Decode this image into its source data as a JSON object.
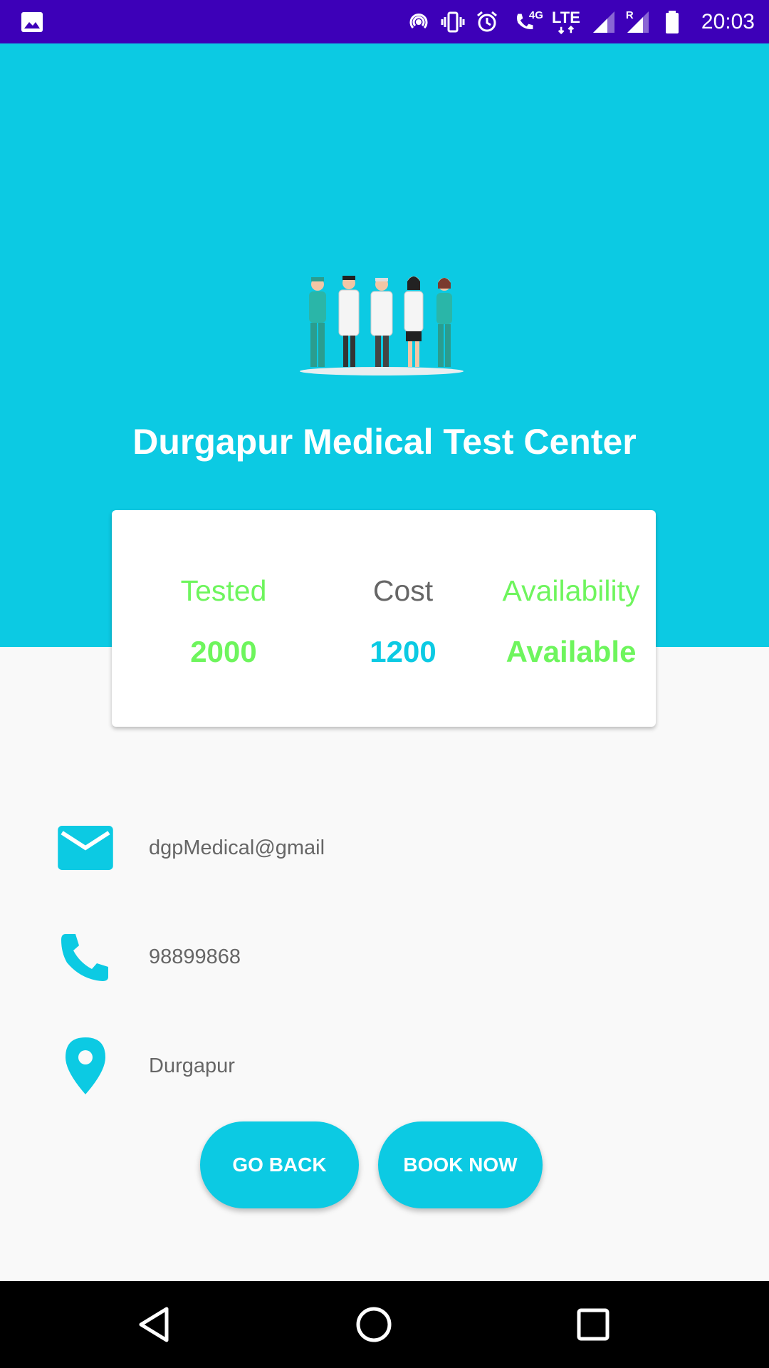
{
  "status_bar": {
    "time": "20:03",
    "network_label": "4G",
    "lte_label": "LTE",
    "roaming_label": "R"
  },
  "header": {
    "title": "Durgapur Medical Test Center"
  },
  "stats": {
    "tested_label": "Tested",
    "tested_value": "2000",
    "cost_label": "Cost",
    "cost_value": "1200",
    "availability_label": "Availability",
    "availability_value": "Available"
  },
  "contact": {
    "email": "dgpMedical@gmail",
    "phone": "98899868",
    "location": "Durgapur"
  },
  "buttons": {
    "go_back": "GO BACK",
    "book_now": "BOOK NOW"
  },
  "colors": {
    "accent": "#0ccae3",
    "status_bar": "#3d00b8",
    "green": "#6ef55d",
    "grey_text": "#666666"
  }
}
